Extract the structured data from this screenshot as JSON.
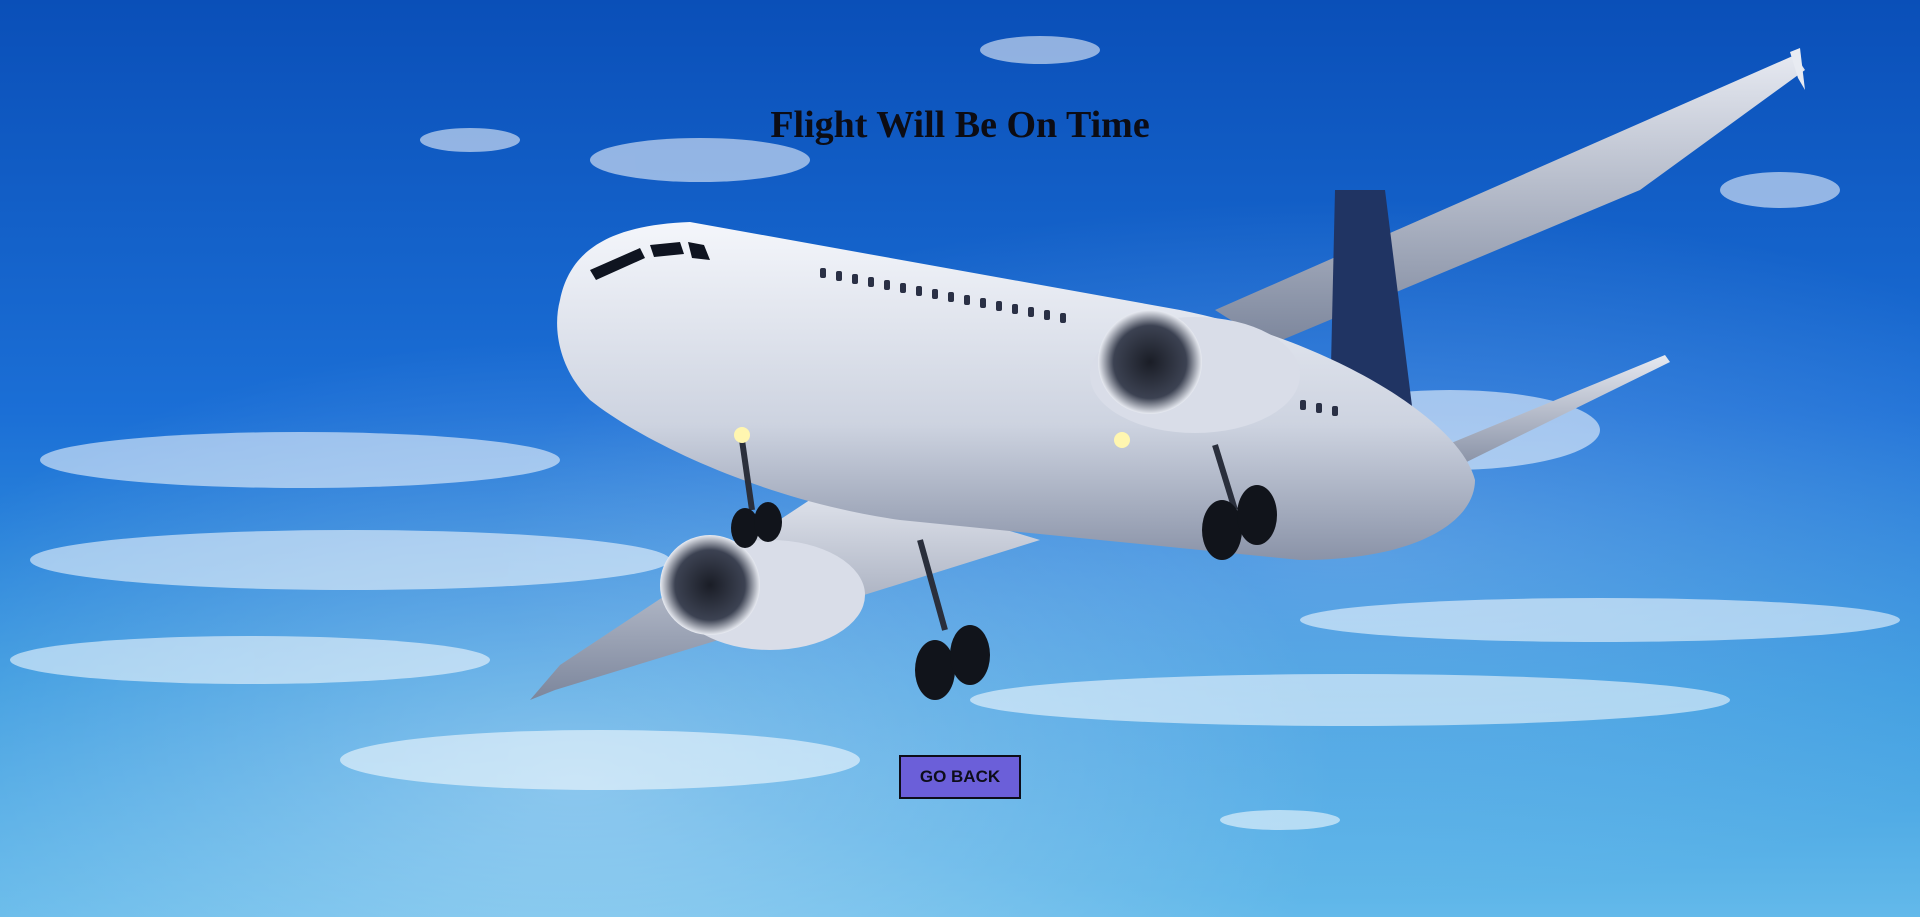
{
  "page": {
    "title": "Flight Will Be On Time",
    "go_back_label": "GO BACK",
    "background_image": "airplane-in-blue-sky"
  },
  "colors": {
    "sky_top": "#0a4fb8",
    "sky_bottom": "#63b9ea",
    "button_bg": "#6b5fd9",
    "title_text": "#0c0c14"
  }
}
